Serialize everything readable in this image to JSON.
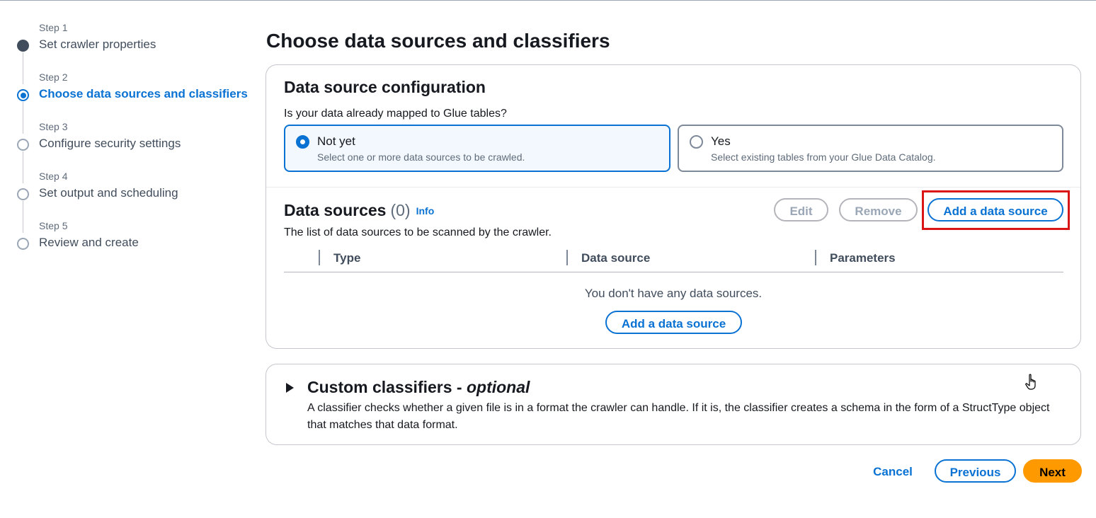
{
  "steps": [
    {
      "num": "Step 1",
      "title": "Set crawler properties",
      "state": "done"
    },
    {
      "num": "Step 2",
      "title": "Choose data sources and classifiers",
      "state": "current"
    },
    {
      "num": "Step 3",
      "title": "Configure security settings",
      "state": "todo"
    },
    {
      "num": "Step 4",
      "title": "Set output and scheduling",
      "state": "todo"
    },
    {
      "num": "Step 5",
      "title": "Review and create",
      "state": "todo"
    }
  ],
  "page_title": "Choose data sources and classifiers",
  "config": {
    "title": "Data source configuration",
    "question": "Is your data already mapped to Glue tables?",
    "options": [
      {
        "label": "Not yet",
        "desc": "Select one or more data sources to be crawled.",
        "selected": true
      },
      {
        "label": "Yes",
        "desc": "Select existing tables from your Glue Data Catalog.",
        "selected": false
      }
    ]
  },
  "data_sources": {
    "title": "Data sources",
    "count": "(0)",
    "info": "Info",
    "description": "The list of data sources to be scanned by the crawler.",
    "edit_label": "Edit",
    "remove_label": "Remove",
    "add_label": "Add a data source",
    "columns": [
      "Type",
      "Data source",
      "Parameters"
    ],
    "empty_message": "You don't have any data sources.",
    "empty_add_label": "Add a data source"
  },
  "classifiers": {
    "title": "Custom classifiers - ",
    "optional": "optional",
    "description": "A classifier checks whether a given file is in a format the crawler can handle. If it is, the classifier creates a schema in the form of a StructType object that matches that data format."
  },
  "footer": {
    "cancel": "Cancel",
    "previous": "Previous",
    "next": "Next"
  },
  "colors": {
    "accent": "#0972d3",
    "primary_button": "#ff9900",
    "highlight": "#d91515"
  }
}
